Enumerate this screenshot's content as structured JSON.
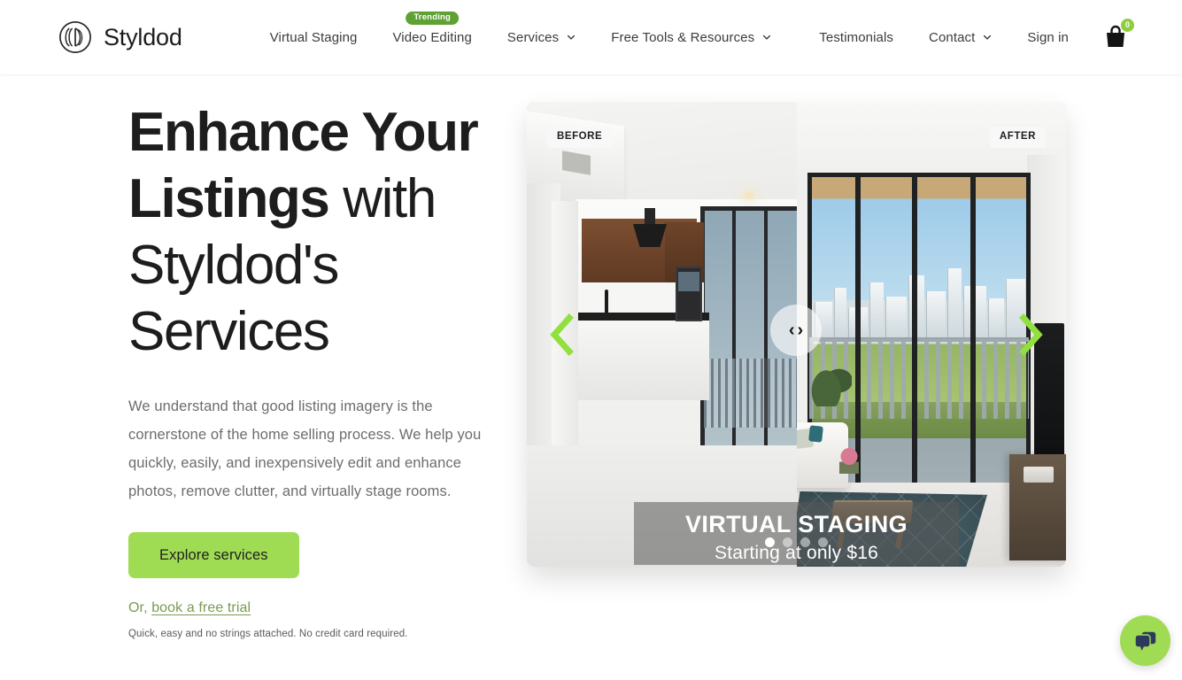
{
  "brand": {
    "name": "Styldod",
    "logo_icon": "styldod-circle-logo"
  },
  "nav": {
    "items": [
      {
        "label": "Virtual Staging",
        "has_caret": false,
        "badge": null
      },
      {
        "label": "Video Editing",
        "has_caret": false,
        "badge": "Trending"
      },
      {
        "label": "Services",
        "has_caret": true,
        "badge": null
      },
      {
        "label": "Free Tools & Resources",
        "has_caret": true,
        "badge": null
      }
    ],
    "right_items": [
      {
        "label": "Testimonials",
        "has_caret": false
      },
      {
        "label": "Contact",
        "has_caret": true
      },
      {
        "label": "Sign in",
        "has_caret": false
      }
    ],
    "cart": {
      "icon": "shopping-bag-icon",
      "count": "0"
    }
  },
  "hero": {
    "title_bold": "Enhance Your Listings",
    "title_rest": " with Styldod's Services",
    "subtitle": "We understand that good listing imagery is the cornerstone of the home selling process. We help you quickly, easily, and inexpensively edit and enhance photos, remove clutter, and virtually stage rooms.",
    "cta_label": "Explore services",
    "trial_prefix": "Or, ",
    "trial_link": "book a free trial",
    "fineprint": "Quick, easy and no strings attached. No credit card required."
  },
  "carousel": {
    "label_before": "BEFORE",
    "label_after": "AFTER",
    "handle_icon": "split-compare-handle",
    "prev_icon": "chevron-left-icon",
    "next_icon": "chevron-right-icon",
    "caption_title": "VIRTUAL STAGING",
    "caption_subtitle": "Starting at only $16",
    "dots_total": 4,
    "active_dot": 1
  },
  "chat": {
    "icon": "chat-bubble-icon"
  },
  "colors": {
    "accent_green": "#9fdc54",
    "badge_green": "#5fa233",
    "link_green": "#7a9b52",
    "text_dark": "#1d1d1d",
    "text_muted": "#6d6d6d"
  }
}
